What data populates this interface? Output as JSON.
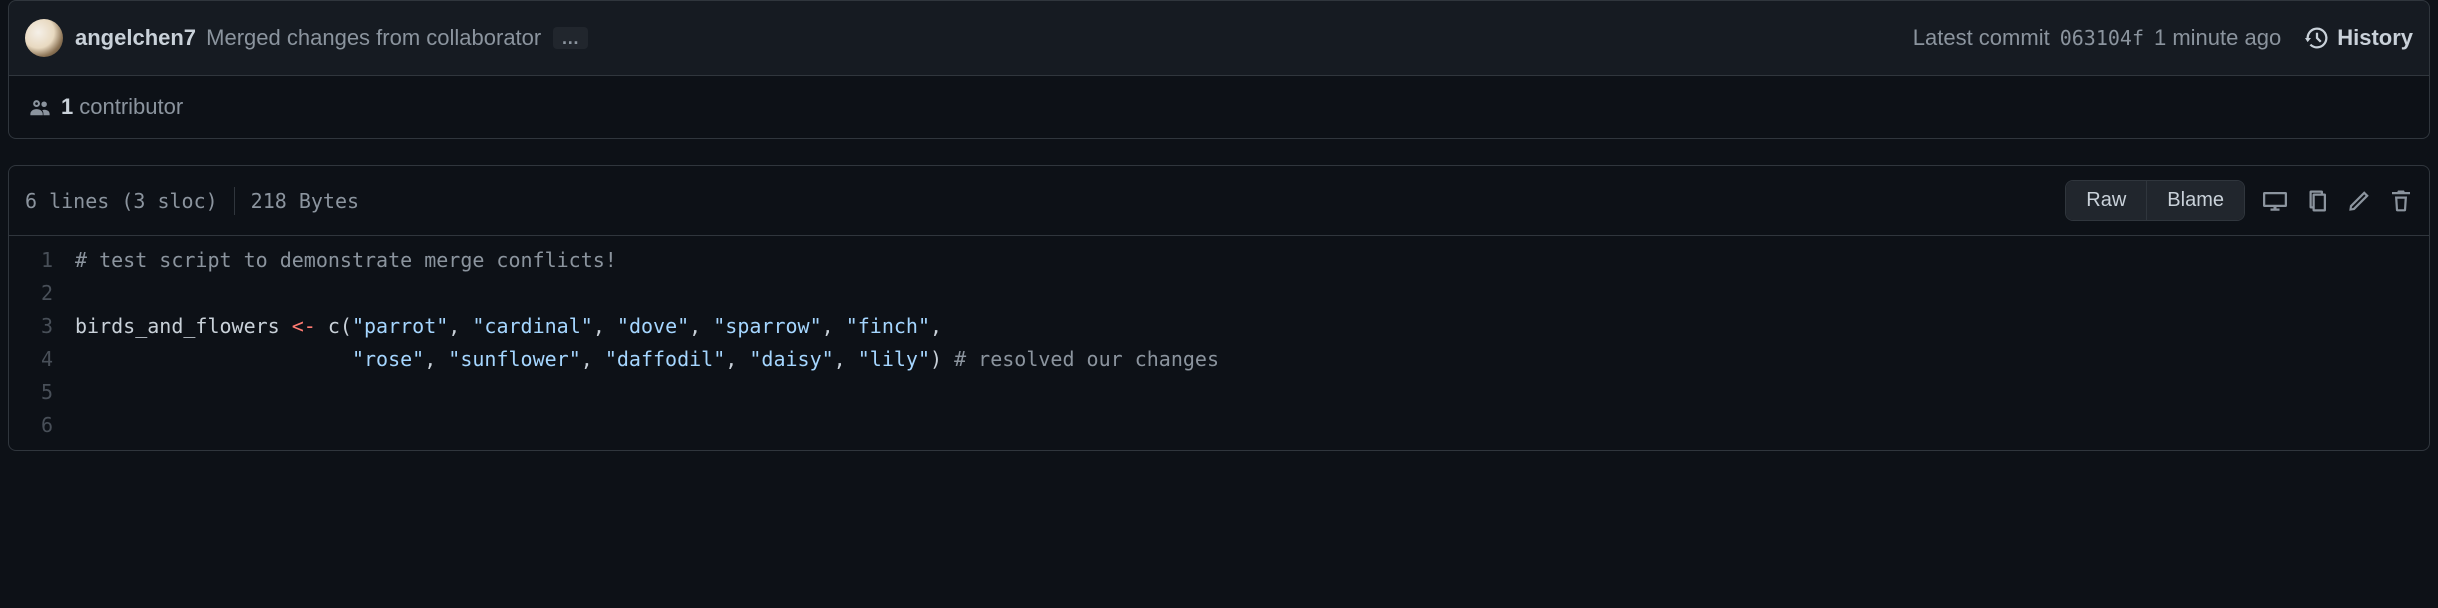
{
  "commit": {
    "author": "angelchen7",
    "message": "Merged changes from collaborator",
    "latest_label": "Latest commit",
    "sha": "063104f",
    "relative_time": "1 minute ago",
    "history_label": "History",
    "more": "…"
  },
  "contributors": {
    "count": "1",
    "label": "contributor"
  },
  "file": {
    "lines_sloc": "6 lines (3 sloc)",
    "bytes": "218 Bytes",
    "raw_label": "Raw",
    "blame_label": "Blame"
  },
  "code": {
    "lines": [
      {
        "n": "1",
        "segments": [
          {
            "cls": "comment",
            "t": "# test script to demonstrate merge conflicts!"
          }
        ]
      },
      {
        "n": "2",
        "segments": []
      },
      {
        "n": "3",
        "segments": [
          {
            "cls": "var",
            "t": "birds_and_flowers"
          },
          {
            "cls": "",
            "t": " "
          },
          {
            "cls": "op",
            "t": "<-"
          },
          {
            "cls": "",
            "t": " c("
          },
          {
            "cls": "str",
            "t": "\"parrot\""
          },
          {
            "cls": "",
            "t": ", "
          },
          {
            "cls": "str",
            "t": "\"cardinal\""
          },
          {
            "cls": "",
            "t": ", "
          },
          {
            "cls": "str",
            "t": "\"dove\""
          },
          {
            "cls": "",
            "t": ", "
          },
          {
            "cls": "str",
            "t": "\"sparrow\""
          },
          {
            "cls": "",
            "t": ", "
          },
          {
            "cls": "str",
            "t": "\"finch\""
          },
          {
            "cls": "",
            "t": ","
          }
        ]
      },
      {
        "n": "4",
        "segments": [
          {
            "cls": "",
            "t": "                       "
          },
          {
            "cls": "str",
            "t": "\"rose\""
          },
          {
            "cls": "",
            "t": ", "
          },
          {
            "cls": "str",
            "t": "\"sunflower\""
          },
          {
            "cls": "",
            "t": ", "
          },
          {
            "cls": "str",
            "t": "\"daffodil\""
          },
          {
            "cls": "",
            "t": ", "
          },
          {
            "cls": "str",
            "t": "\"daisy\""
          },
          {
            "cls": "",
            "t": ", "
          },
          {
            "cls": "str",
            "t": "\"lily\""
          },
          {
            "cls": "",
            "t": ") "
          },
          {
            "cls": "comment",
            "t": "# resolved our changes"
          }
        ]
      },
      {
        "n": "5",
        "segments": []
      },
      {
        "n": "6",
        "segments": []
      }
    ]
  }
}
